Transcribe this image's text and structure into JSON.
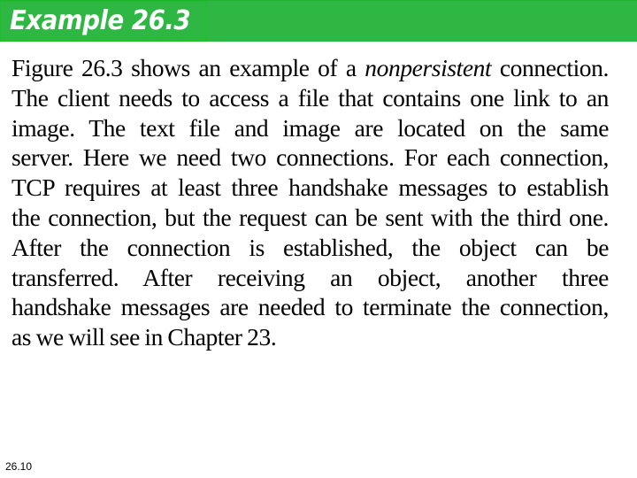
{
  "header": {
    "title": "Example 26.3",
    "bar_color": "#2eb843"
  },
  "content": {
    "lines": [
      {
        "parts": [
          {
            "text": "Figure 26.3 shows an example of a ",
            "italic": false
          },
          {
            "text": "nonpersistent",
            "italic": true
          },
          {
            "text": " connection.",
            "italic": false
          }
        ]
      },
      {
        "parts": [
          {
            "text": "The client needs to access a file that contains one link to an",
            "italic": false
          }
        ]
      },
      {
        "parts": [
          {
            "text": "image. The text file and image are located on the same",
            "italic": false
          }
        ]
      },
      {
        "parts": [
          {
            "text": "server. Here we need two connections. For each connection,",
            "italic": false
          }
        ]
      },
      {
        "parts": [
          {
            "text": "TCP requires at least three handshake messages to establish",
            "italic": false
          }
        ]
      },
      {
        "parts": [
          {
            "text": "the connection, but the request can be sent with the third one.",
            "italic": false
          }
        ]
      },
      {
        "parts": [
          {
            "text": "After the connection is established, the object can be",
            "italic": false
          }
        ]
      },
      {
        "parts": [
          {
            "text": "transferred. After receiving an object, another three",
            "italic": false
          }
        ]
      },
      {
        "parts": [
          {
            "text": "handshake messages are needed to terminate the connection,",
            "italic": false
          }
        ]
      },
      {
        "parts": [
          {
            "text": "as we will see in Chapter 23.",
            "italic": false
          }
        ]
      }
    ]
  },
  "footer": {
    "page_number": "26.10"
  }
}
